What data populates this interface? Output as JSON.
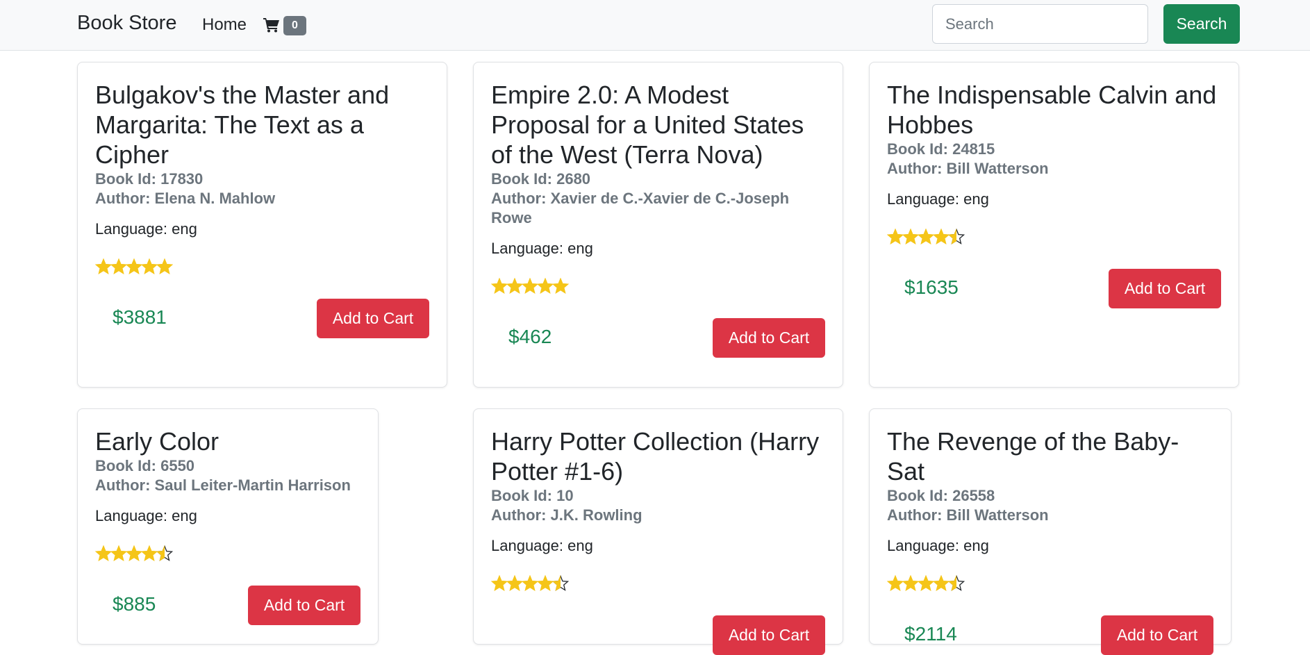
{
  "navbar": {
    "brand": "Book Store",
    "home_label": "Home",
    "cart_icon": "shopping-cart-icon",
    "cart_count": "0",
    "search_placeholder": "Search",
    "search_value": "",
    "search_button": "Search"
  },
  "colors": {
    "navbar_bg": "#f8f9fa",
    "search_button": "#198754",
    "add_to_cart_button": "#dc3545",
    "price": "#198754",
    "badge": "#6c757d",
    "star": "#f5c518"
  },
  "books": [
    {
      "title": "Bulgakov's the Master and Margarita: The Text as a Cipher",
      "book_id": "Book Id: 17830",
      "author": "Author: Elena N. Mahlow",
      "language": "Language: eng",
      "rating": 5,
      "price": "$3881",
      "button": "Add to Cart"
    },
    {
      "title": "Empire 2.0: A Modest Proposal for a United States of the West (Terra Nova)",
      "book_id": "Book Id: 2680",
      "author": "Author: Xavier de C.-Xavier de C.-Joseph Rowe",
      "language": "Language: eng",
      "rating": 5,
      "price": "$462",
      "button": "Add to Cart"
    },
    {
      "title": "The Indispensable Calvin and Hobbes",
      "book_id": "Book Id: 24815",
      "author": "Author: Bill Watterson",
      "language": "Language: eng",
      "rating": 4.5,
      "price": "$1635",
      "button": "Add to Cart"
    },
    {
      "title": "Early Color",
      "book_id": "Book Id: 6550",
      "author": "Author: Saul Leiter-Martin Harrison",
      "language": "Language: eng",
      "rating": 4.5,
      "price": "$885",
      "button": "Add to Cart"
    },
    {
      "title": "Harry Potter Collection (Harry Potter #1-6)",
      "book_id": "Book Id: 10",
      "author": "Author: J.K. Rowling",
      "language": "Language: eng",
      "rating": 4.5,
      "price": "",
      "button": "Add to Cart"
    },
    {
      "title": "The Revenge of the Baby-Sat",
      "book_id": "Book Id: 26558",
      "author": "Author: Bill Watterson",
      "language": "Language: eng",
      "rating": 4.5,
      "price": "$2114",
      "button": "Add to Cart"
    }
  ]
}
